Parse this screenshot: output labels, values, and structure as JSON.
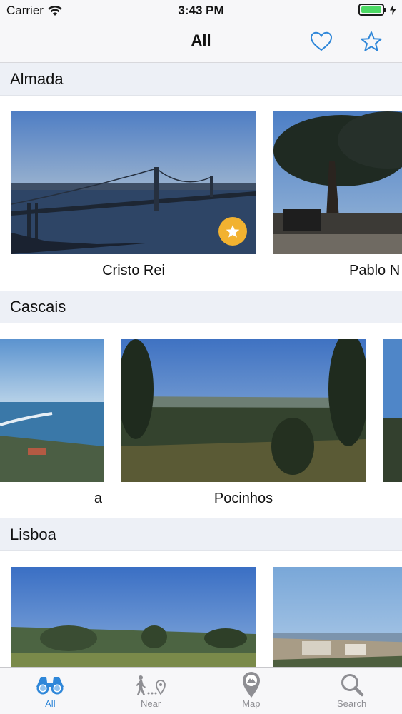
{
  "status_bar": {
    "carrier": "Carrier",
    "time": "3:43 PM"
  },
  "nav": {
    "title": "All",
    "heart_icon": "heart-outline-icon",
    "star_icon": "star-outline-icon"
  },
  "sections": [
    {
      "title": "Almada",
      "items": [
        {
          "label": "Cristo Rei",
          "favorite": true
        },
        {
          "label": "Pablo N"
        }
      ]
    },
    {
      "title": "Cascais",
      "items": [
        {
          "label": "a"
        },
        {
          "label": "Pocinhos"
        }
      ]
    },
    {
      "title": "Lisboa",
      "items": [
        {
          "label": ""
        },
        {
          "label": ""
        }
      ]
    }
  ],
  "tabs": [
    {
      "label": "All",
      "icon": "binoculars-icon",
      "active": true
    },
    {
      "label": "Near",
      "icon": "walking-pin-icon",
      "active": false
    },
    {
      "label": "Map",
      "icon": "map-pin-icon",
      "active": false
    },
    {
      "label": "Search",
      "icon": "magnifier-icon",
      "active": false
    }
  ],
  "colors": {
    "accent": "#2f87d9",
    "favorite_badge": "#f2b230",
    "section_header_bg": "#edf0f6"
  }
}
